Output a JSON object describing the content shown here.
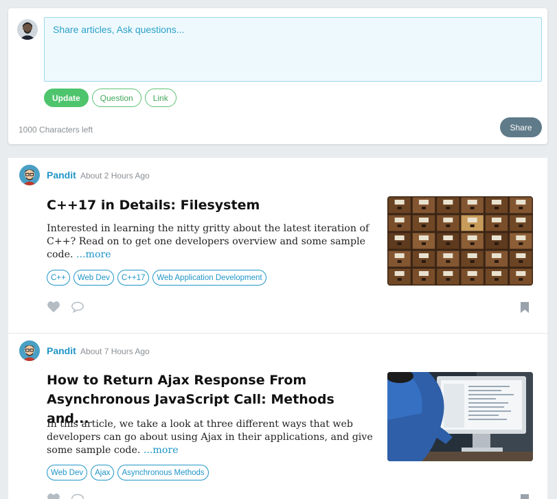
{
  "composer": {
    "placeholder": "Share articles, Ask questions...",
    "type_buttons": [
      "Update",
      "Question",
      "Link"
    ],
    "chars_left": "1000 Characters left",
    "share_label": "Share"
  },
  "posts": [
    {
      "author": "Pandit",
      "time": "About 2 Hours Ago",
      "title": "C++17 in Details: Filesystem",
      "excerpt": "Interested in learning the nitty gritty about the latest iteration of C++? Read on to get one developers overview and some sample code.",
      "more": "...more",
      "tags": [
        "C++",
        "Web Dev",
        "C++17",
        "Web Application Development"
      ],
      "thumb_icon": "card-catalog-drawers-photo"
    },
    {
      "author": "Pandit",
      "time": "About 7 Hours Ago",
      "title": "How to Return Ajax Response From Asynchronous JavaScript Call: Methods and...",
      "excerpt": "In this article, we take a look at three different ways that web developers can go about using Ajax in their applications, and give some sample code.",
      "more": "...more",
      "tags": [
        "Web Dev",
        "Ajax",
        "Asynchronous Methods"
      ],
      "thumb_icon": "developer-at-monitor-photo"
    }
  ],
  "colors": {
    "accent_blue": "#1f95c8",
    "green": "#4ec46c",
    "share_gray": "#5f7a89",
    "background": "#e9ecef"
  }
}
